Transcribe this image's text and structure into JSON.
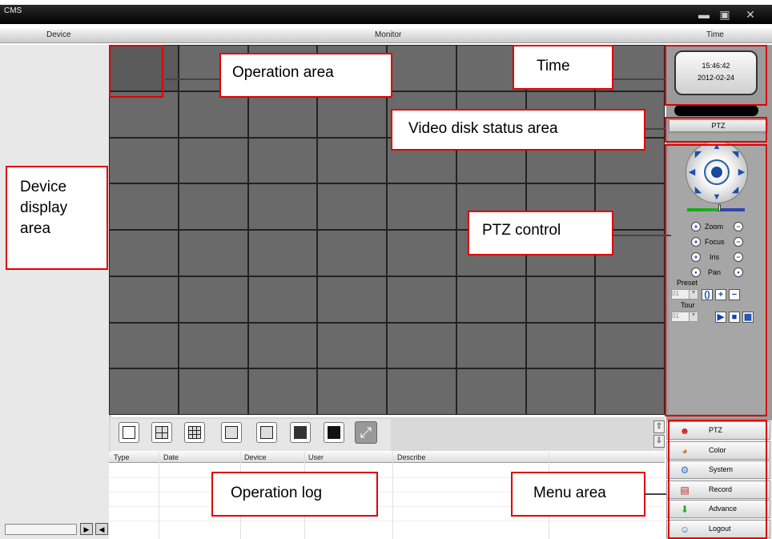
{
  "window": {
    "title": "CMS",
    "minimize_icon": "minimize-icon",
    "restore_icon": "restore-icon",
    "close_icon": "close-icon"
  },
  "header": {
    "device": "Device",
    "monitor": "Monitor",
    "time": "Time"
  },
  "clock": {
    "time": "15:46:42",
    "date": "2012-02-24"
  },
  "ptz": {
    "title": "PTZ",
    "controls": [
      {
        "label": "Zoom",
        "plus": "+",
        "minus": "−"
      },
      {
        "label": "Focus",
        "plus": "+",
        "minus": "−"
      },
      {
        "label": "Iris",
        "plus": "+",
        "minus": "−"
      },
      {
        "label": "Pan",
        "plus": "•",
        "minus": "•"
      }
    ],
    "preset_label": "Preset",
    "preset_value": "01",
    "tour_label": "Tour",
    "tour_value": "01"
  },
  "log": {
    "columns": [
      "Type",
      "Date",
      "Device",
      "User",
      "Describe"
    ]
  },
  "menu": [
    {
      "label": "PTZ",
      "icon": "ptz-icon",
      "color": "#d02020"
    },
    {
      "label": "Color",
      "icon": "color-icon",
      "color": "#e07010"
    },
    {
      "label": "System",
      "icon": "system-icon",
      "color": "#3070c0"
    },
    {
      "label": "Record",
      "icon": "record-icon",
      "color": "#c02020"
    },
    {
      "label": "Advance",
      "icon": "advance-icon",
      "color": "#30a030"
    },
    {
      "label": "Logout",
      "icon": "logout-icon",
      "color": "#3070c0"
    }
  ],
  "annotations": {
    "operation_area": "Operation area",
    "time": "Time",
    "video_disk": "Video disk status area",
    "device_display": "Device display area",
    "ptz_control": "PTZ control",
    "operation_log": "Operation log",
    "menu_area": "Menu area"
  },
  "colors": {
    "annotation_border": "#e00000",
    "joystick": "#1a4fae"
  }
}
